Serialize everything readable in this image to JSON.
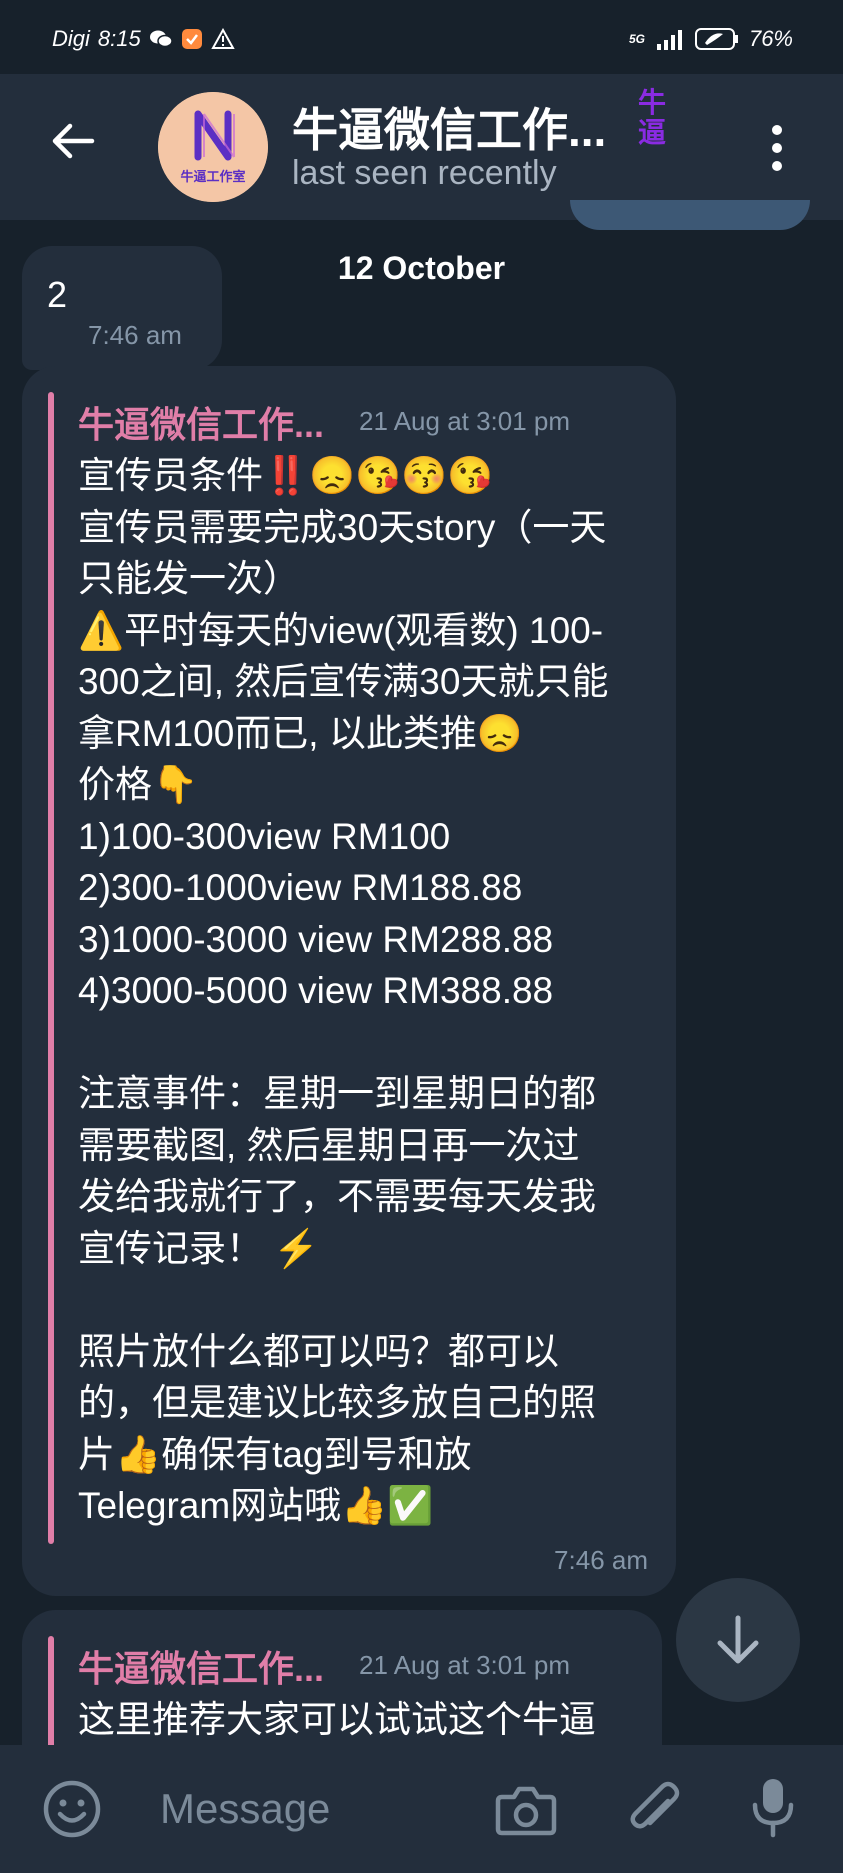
{
  "status": {
    "carrier": "Digi",
    "time": "8:15",
    "network": "5G",
    "battery": "76%"
  },
  "chat_header": {
    "title": "牛逼微信工作...",
    "subtitle": "last seen recently",
    "avatar_text": "牛逼工作室",
    "side_tag": "牛逼"
  },
  "chat": {
    "date_separator": "12 October",
    "message1": {
      "text": "2",
      "time": "7:46 am"
    },
    "message2": {
      "sender": "牛逼微信工作...",
      "stamp": "21 Aug at 3:01 pm",
      "lines": [
        "宣传员条件‼️😞😘😚😘",
        "宣传员需要完成30天story（一天",
        "只能发一次）",
        "⚠️平时每天的view(观看数) 100-",
        "300之间, 然后宣传满30天就只能",
        "拿RM100而已, 以此类推😞",
        "价格👇",
        "1)100-300view RM100",
        "2)300-1000view RM188.88",
        "3)1000-3000 view RM288.88",
        "4)3000-5000 view RM388.88",
        "",
        "注意事件：星期一到星期日的都",
        "需要截图, 然后星期日再一次过",
        "发给我就行了，不需要每天发我",
        "宣传记录！ ⚡",
        "",
        "照片放什么都可以吗？都可以",
        "的，但是建议比较多放自己的照",
        "片👍确保有tag到号和放",
        "Telegram网站哦👍✅"
      ],
      "time": "7:46 am"
    },
    "message3": {
      "sender": "牛逼微信工作...",
      "stamp": "21 Aug at 3:01 pm",
      "first_line": "这里推荐大家可以试试这个牛逼"
    }
  },
  "input": {
    "placeholder": "Message"
  },
  "colors": {
    "background": "#17212b",
    "header": "#232e3c",
    "bubble": "#232e3c",
    "quote_accent": "#e07ea8",
    "muted_text": "#8596a8"
  }
}
